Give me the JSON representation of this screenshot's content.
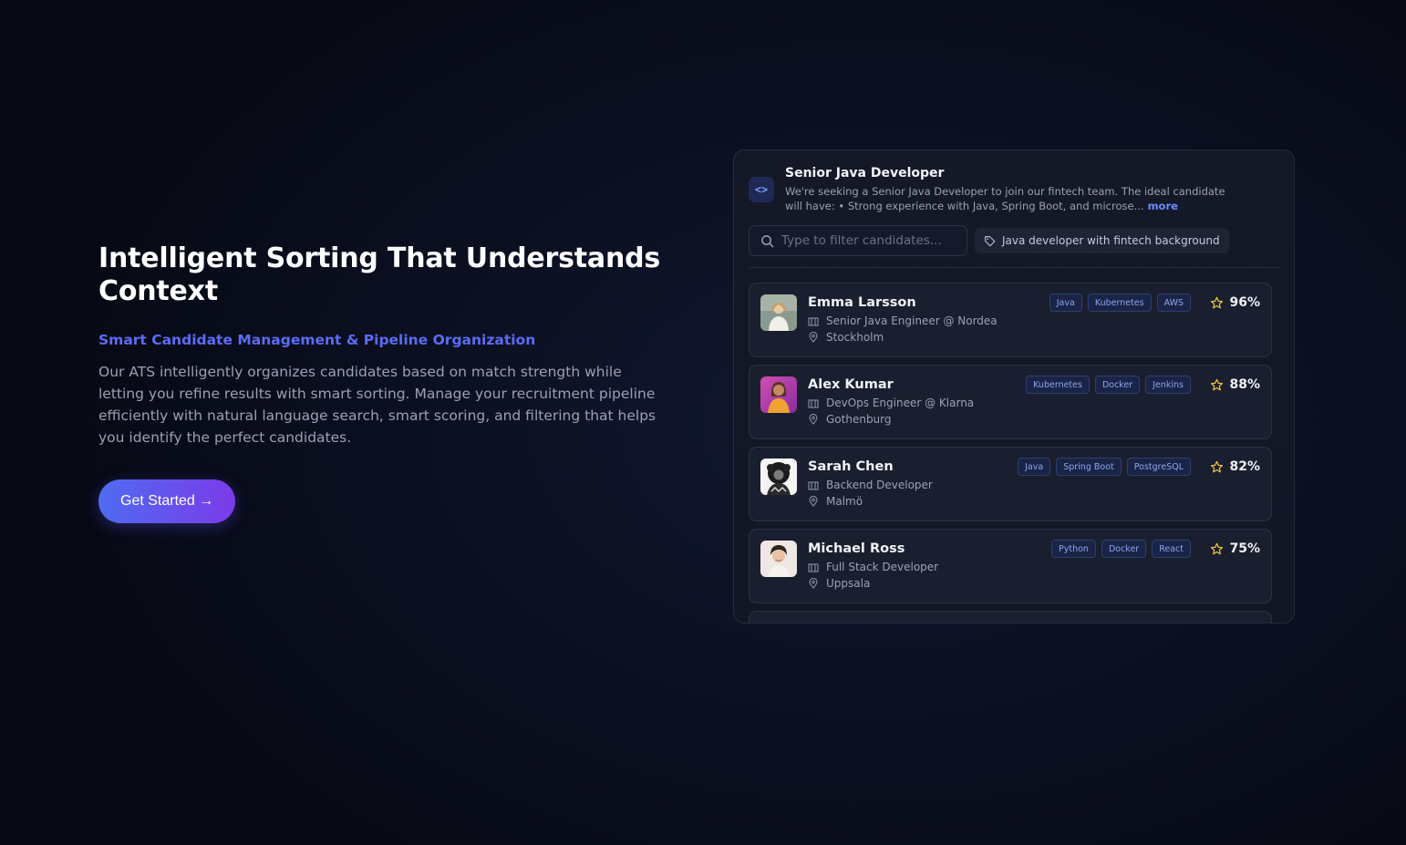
{
  "hero": {
    "title": "Intelligent Sorting That Understands Context",
    "subtitle": "Smart Candidate Management & Pipeline Organization",
    "description": "Our ATS intelligently organizes candidates based on match strength while letting you refine results with smart sorting. Manage your recruitment pipeline efficiently with natural language search, smart scoring, and filtering that helps you identify the perfect candidates.",
    "cta_label": "Get Started →"
  },
  "job": {
    "icon": "code-icon",
    "title": "Senior Java Developer",
    "description": "We're seeking a Senior Java Developer to join our fintech team. The ideal candidate will have: • Strong experience with Java, Spring Boot, and microse...",
    "more_label": "more"
  },
  "filters": {
    "search_placeholder": "Type to filter candidates...",
    "tag_label": "Java developer with fintech background"
  },
  "candidates": [
    {
      "name": "Emma Larsson",
      "role": "Senior Java Engineer @ Nordea",
      "location": "Stockholm",
      "skills": [
        "Java",
        "Kubernetes",
        "AWS"
      ],
      "score": "96%"
    },
    {
      "name": "Alex Kumar",
      "role": "DevOps Engineer @ Klarna",
      "location": "Gothenburg",
      "skills": [
        "Kubernetes",
        "Docker",
        "Jenkins"
      ],
      "score": "88%"
    },
    {
      "name": "Sarah Chen",
      "role": "Backend Developer",
      "location": "Malmö",
      "skills": [
        "Java",
        "Spring Boot",
        "PostgreSQL"
      ],
      "score": "82%"
    },
    {
      "name": "Michael Ross",
      "role": "Full Stack Developer",
      "location": "Uppsala",
      "skills": [
        "Python",
        "Docker",
        "React"
      ],
      "score": "75%"
    }
  ],
  "colors": {
    "accent": "#5b6cf5",
    "star": "#f5c542",
    "skill_text": "#8ea6ee"
  }
}
